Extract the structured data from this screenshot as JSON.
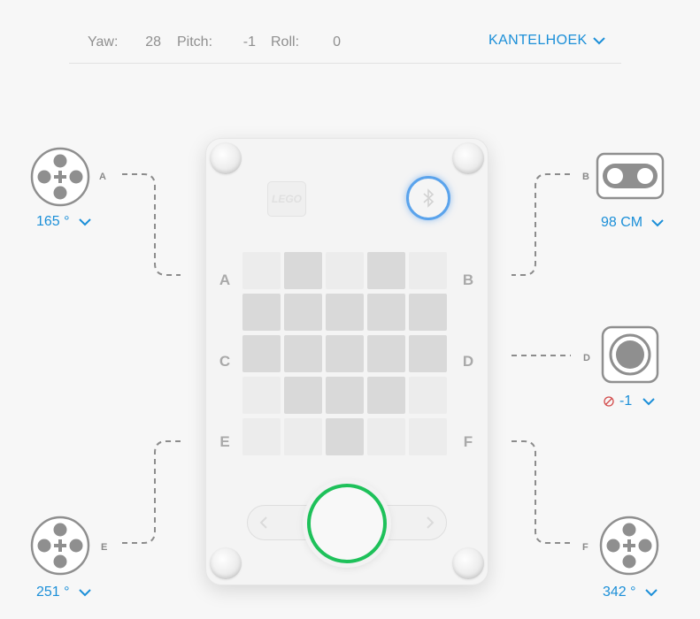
{
  "top_bar": {
    "yaw_label": "Yaw:",
    "yaw_value": "28",
    "pitch_label": "Pitch:",
    "pitch_value": "-1",
    "roll_label": "Roll:",
    "roll_value": "0",
    "mode_label": "KANTELHOEK"
  },
  "hub": {
    "logo_text": "LEGO",
    "port_letters": [
      "A",
      "B",
      "C",
      "D",
      "E",
      "F"
    ],
    "matrix": [
      [
        0,
        1,
        0,
        1,
        0
      ],
      [
        1,
        1,
        1,
        1,
        1
      ],
      [
        1,
        1,
        1,
        1,
        1
      ],
      [
        0,
        1,
        1,
        1,
        0
      ],
      [
        0,
        0,
        1,
        0,
        0
      ]
    ],
    "colors": {
      "pixel_on": "#d9d9d9",
      "pixel_off": "#ececec",
      "center_ring": "#1ec15a",
      "bluetooth": "#4a96eb"
    }
  },
  "devices": {
    "A": {
      "port": "A",
      "type": "motor",
      "reading": "165 °"
    },
    "B": {
      "port": "B",
      "type": "distance-sensor",
      "reading": "98 CM"
    },
    "D": {
      "port": "D",
      "type": "force-sensor",
      "reading": "-1",
      "status_icon": "not-pressed-icon"
    },
    "E": {
      "port": "E",
      "type": "motor",
      "reading": "251 °"
    },
    "F": {
      "port": "F",
      "type": "motor",
      "reading": "342 °"
    }
  },
  "accent_color": "#1b8fd8"
}
